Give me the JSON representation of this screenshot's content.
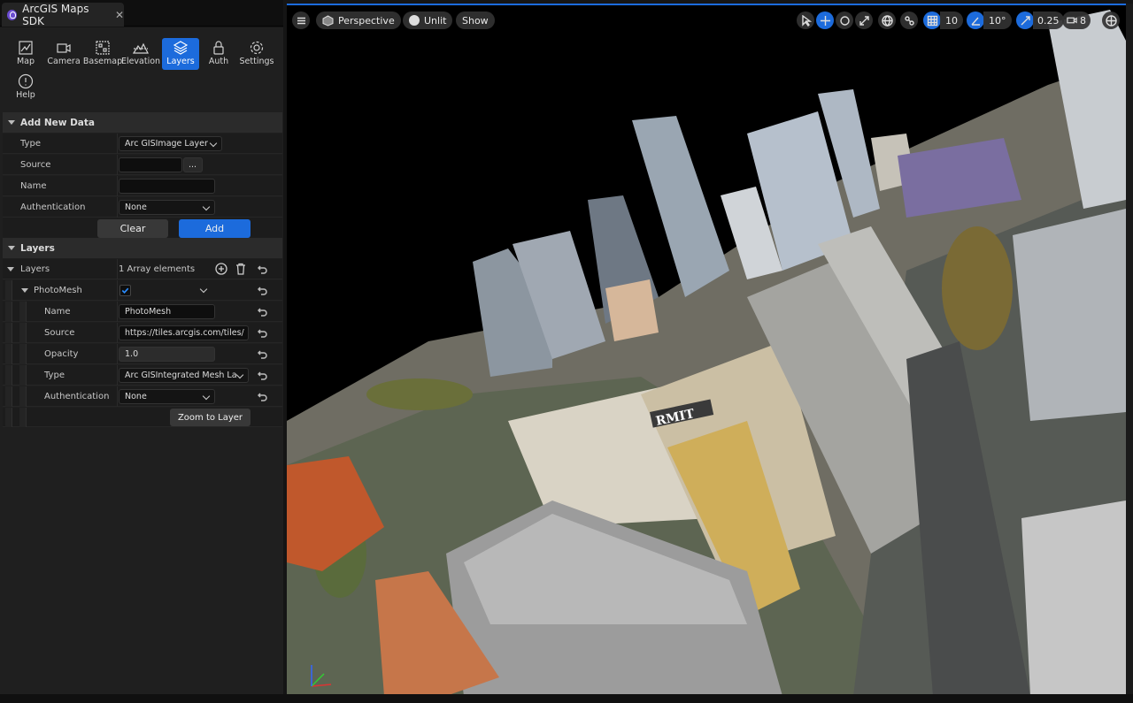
{
  "tab": {
    "title": "ArcGIS Maps SDK",
    "close": "✕"
  },
  "toolbar": {
    "items": [
      {
        "label": "Map",
        "icon": "map-icon"
      },
      {
        "label": "Camera",
        "icon": "camera-icon"
      },
      {
        "label": "Basemap",
        "icon": "basemap-icon"
      },
      {
        "label": "Elevation",
        "icon": "elevation-icon"
      },
      {
        "label": "Layers",
        "icon": "layers-icon",
        "active": true
      },
      {
        "label": "Auth",
        "icon": "lock-icon"
      },
      {
        "label": "Settings",
        "icon": "gear-icon"
      },
      {
        "label": "Help",
        "icon": "help-icon"
      }
    ]
  },
  "add_new_data": {
    "title": "Add New Data",
    "type_label": "Type",
    "type_value": "Arc GISImage Layer",
    "source_label": "Source",
    "source_value": "",
    "browse": "...",
    "name_label": "Name",
    "name_value": "",
    "auth_label": "Authentication",
    "auth_value": "None",
    "clear": "Clear",
    "add": "Add"
  },
  "layers": {
    "title": "Layers",
    "array_label": "Layers",
    "array_count": "1 Array elements",
    "item_label": "PhotoMesh",
    "item_checked": true,
    "fields": {
      "name_label": "Name",
      "name_value": "PhotoMesh",
      "source_label": "Source",
      "source_value": "https://tiles.arcgis.com/tiles/",
      "opacity_label": "Opacity",
      "opacity_value": "1.0",
      "type_label": "Type",
      "type_value": "Arc GISIntegrated Mesh La",
      "auth_label": "Authentication",
      "auth_value": "None"
    },
    "zoom_button": "Zoom to Layer"
  },
  "viewport": {
    "perspective": "Perspective",
    "unlit": "Unlit",
    "show": "Show",
    "grid_snap": "10",
    "angle_snap": "10°",
    "scale_snap": "0.25",
    "camera_speed": "8",
    "sign_text": "RMIT"
  },
  "colors": {
    "accent": "#1c6bdc",
    "panel": "#1f1f1f",
    "section": "#2b2b2b"
  }
}
